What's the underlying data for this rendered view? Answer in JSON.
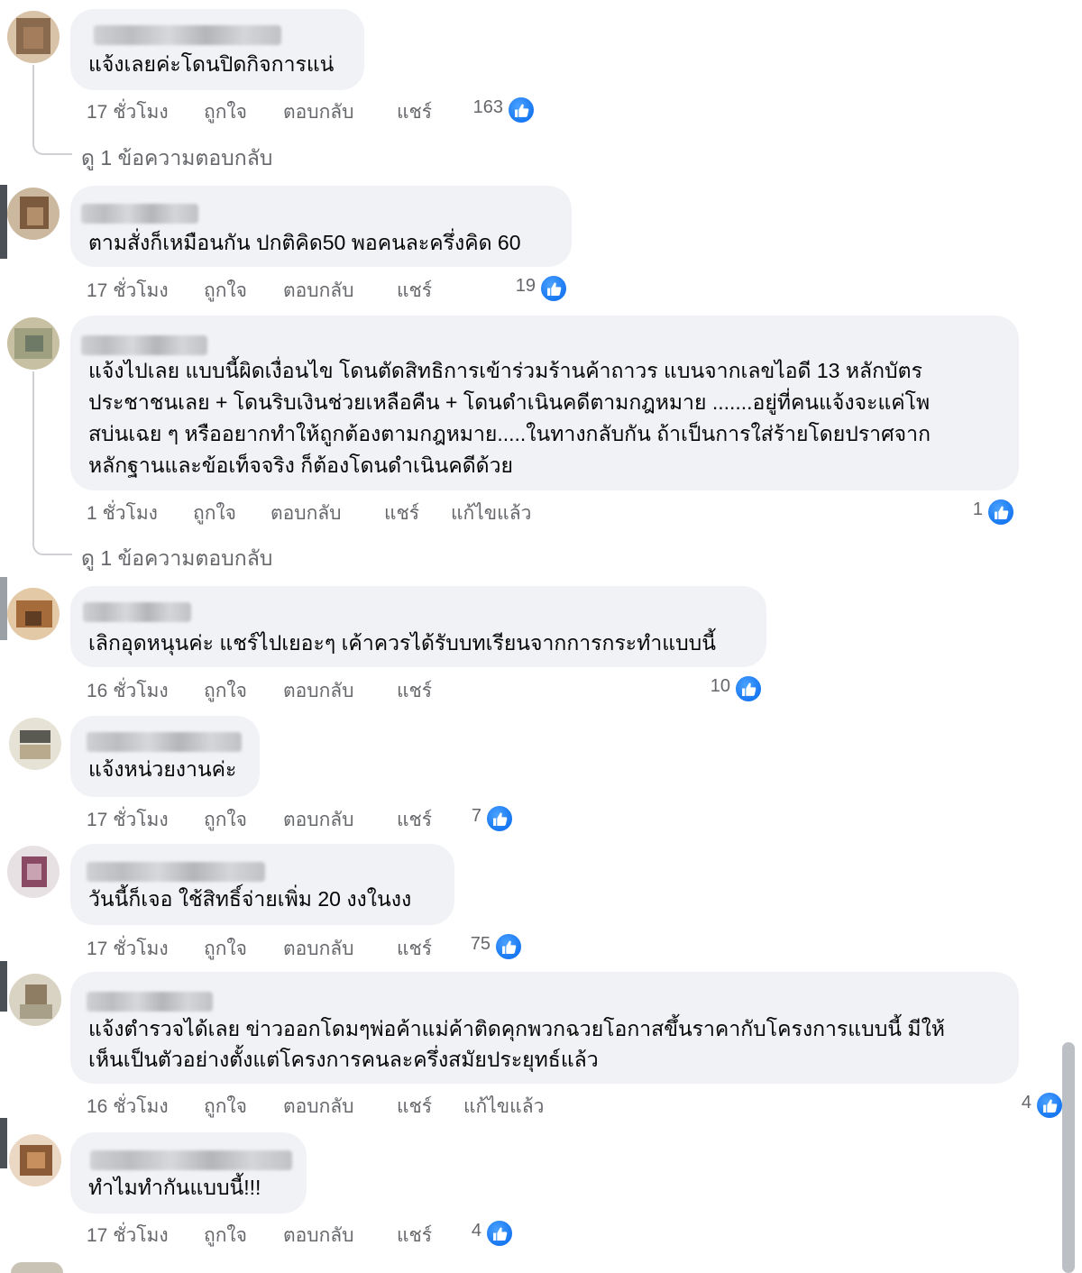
{
  "actions": {
    "like": "ถูกใจ",
    "reply": "ตอบกลับ",
    "share": "แชร์",
    "edited": "แก้ไขแล้ว"
  },
  "view_replies": "ดู 1 ข้อความตอบกลับ",
  "reaction_icon": "like-icon",
  "accent_color": "#1877f2",
  "comments": [
    {
      "text": [
        "แจ้งเลยค่ะโดนปิดกิจการแน่"
      ],
      "time": "17 ชั่วโมง",
      "likes": "163"
    },
    {
      "text": [
        "ตามสั่งก็เหมือนกัน ปกติคิด50 พอคนละครึ่งคิด 60"
      ],
      "time": "17 ชั่วโมง",
      "likes": "19"
    },
    {
      "text": [
        "แจ้งไปเลย แบบนี้ผิดเงื่อนไข โดนตัดสิทธิการเข้าร่วมร้านค้าถาวร แบนจากเลขไอดี 13 หลักบัตร",
        "ประชาชนเลย + โดนริบเงินช่วยเหลือคืน + โดนดำเนินคดีตามกฎหมาย .......อยู่ที่คนแจ้งจะแค่โพ",
        "สบ่นเฉย ๆ หรืออยากทำให้ถูกต้องตามกฎหมาย.....ในทางกลับกัน ถ้าเป็นการใส่ร้ายโดยปราศจาก",
        "หลักฐานและข้อเท็จจริง ก็ต้องโดนดำเนินคดีด้วย"
      ],
      "time": "1 ชั่วโมง",
      "likes": "1",
      "edited": true
    },
    {
      "text": [
        "เลิกอุดหนุนค่ะ แชร์ไปเยอะๆ เค้าควรได้รับบทเรียนจากการกระทำแบบนี้"
      ],
      "time": "16 ชั่วโมง",
      "likes": "10"
    },
    {
      "text": [
        "แจ้งหน่วยงานค่ะ"
      ],
      "time": "17 ชั่วโมง",
      "likes": "7"
    },
    {
      "text": [
        "วันนี้ก็เจอ ใช้สิทธิ์จ่ายเพิ่ม 20 งงในงง"
      ],
      "time": "17 ชั่วโมง",
      "likes": "75"
    },
    {
      "text": [
        "แจ้งตำรวจได้เลย ข่าวออกโดมๆพ่อค้าแม่ค้าติดคุกพวกฉวยโอกาสขึ้นราคากับโครงการแบบนี้ มีให้",
        "เห็นเป็นตัวอย่างตั้งแต่โครงการคนละครึ่งสมัยประยุทธ์แล้ว"
      ],
      "time": "16 ชั่วโมง",
      "likes": "4",
      "edited": true
    },
    {
      "text": [
        "ทำไมทำกันแบบนี้!!!"
      ],
      "time": "17 ชั่วโมง",
      "likes": "4"
    }
  ]
}
